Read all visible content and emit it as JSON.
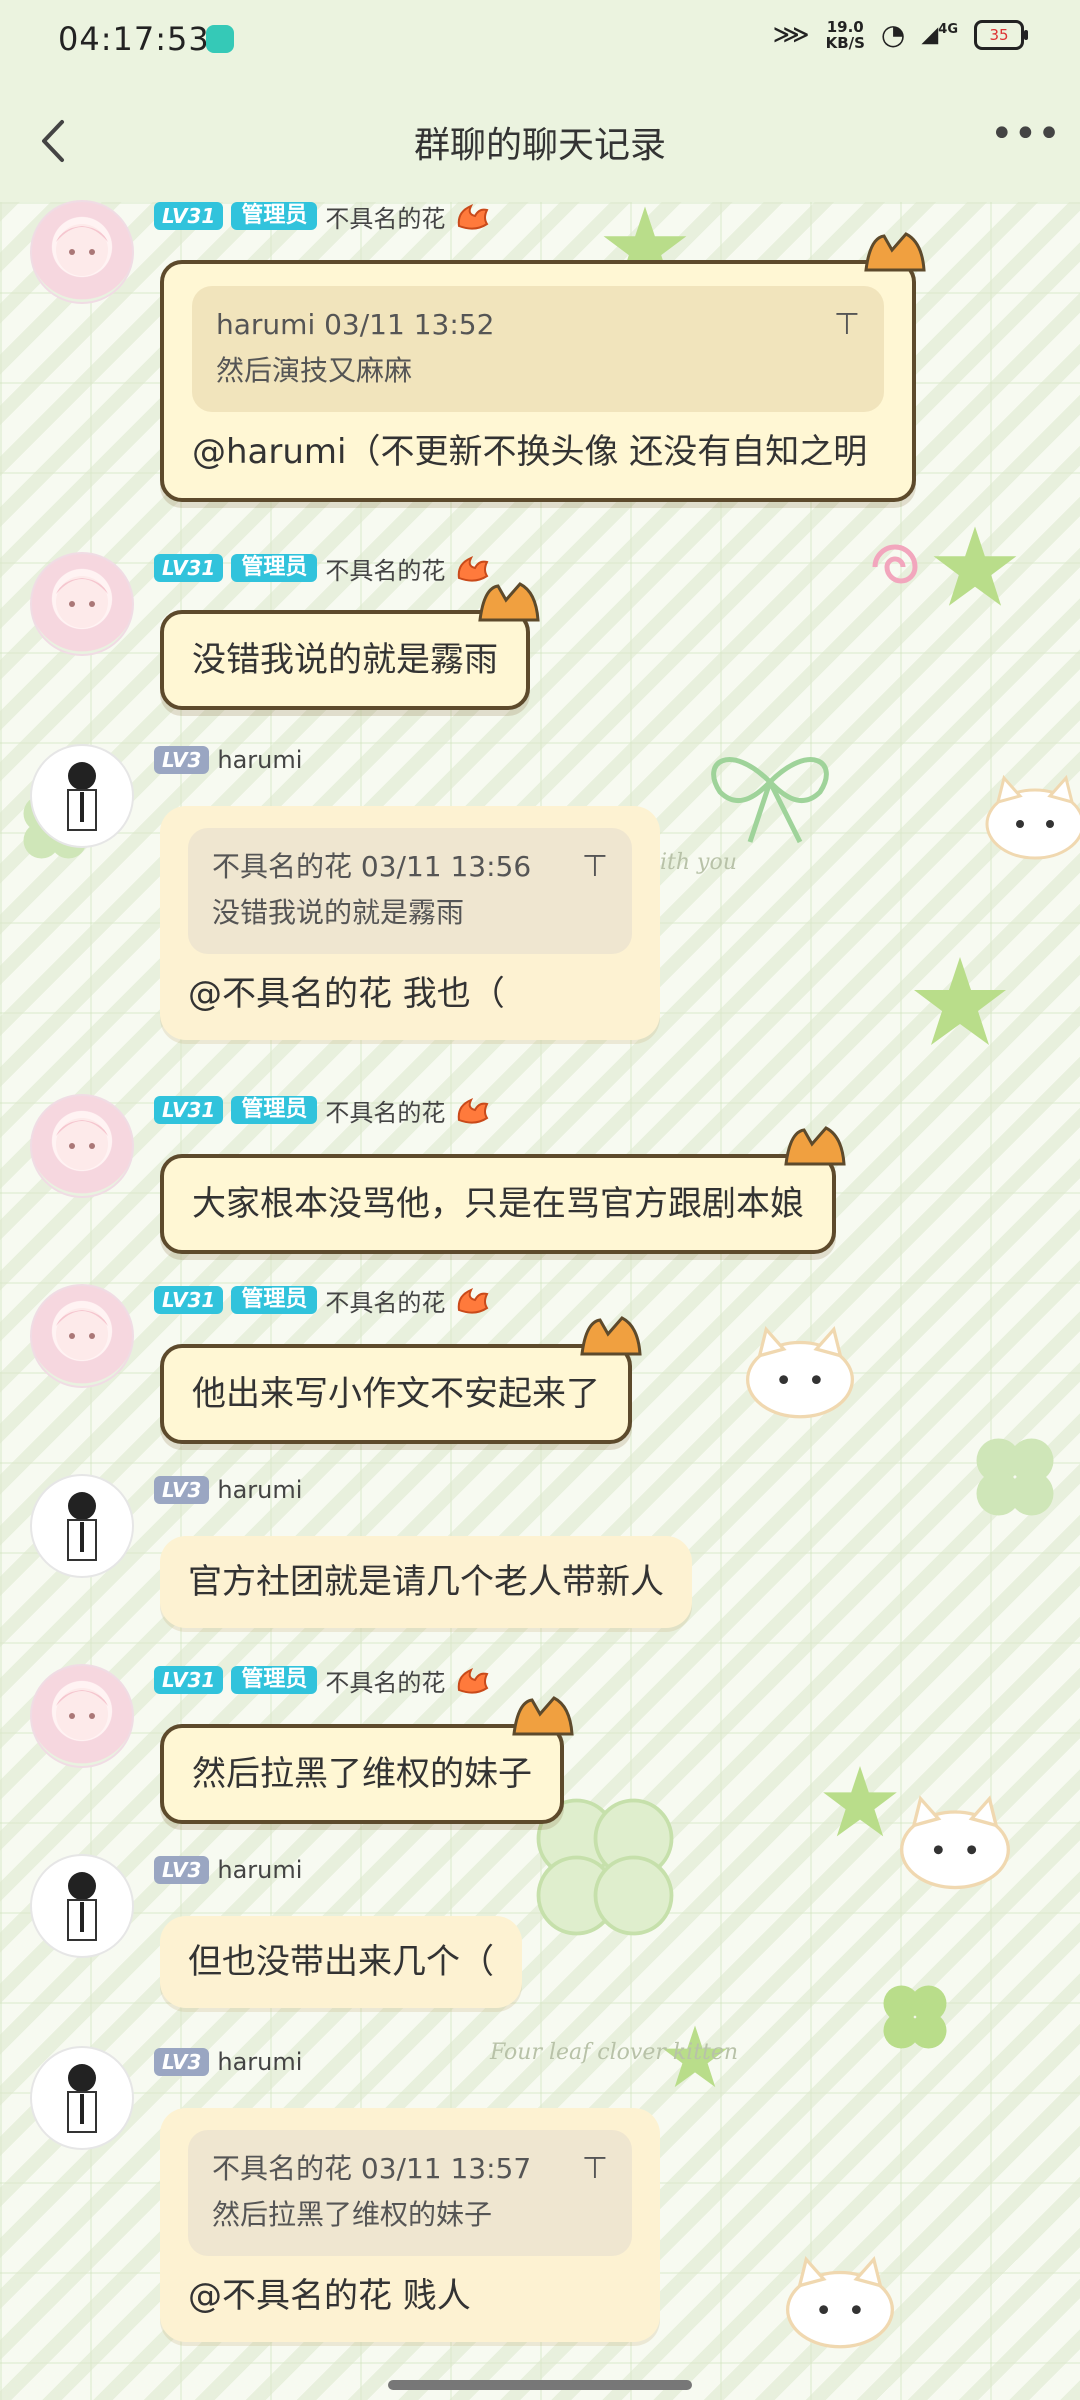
{
  "status_bar": {
    "time": "04:17:53",
    "net_speed_value": "19.0",
    "net_speed_unit": "KB/S",
    "signal_label": "4G",
    "battery": "35"
  },
  "header": {
    "title": "群聊的聊天记录"
  },
  "background_text": {
    "with_you": "ith you",
    "clover": "Four leaf clover kitten"
  },
  "messages": [
    {
      "level": "LV31",
      "role": "管理员",
      "nickname": "不具名的花",
      "quote": {
        "author_time": "harumi 03/11 13:52",
        "text": "然后演技又麻麻"
      },
      "text": "@harumi（不更新不换头像 还没有自知之明"
    },
    {
      "level": "LV31",
      "role": "管理员",
      "nickname": "不具名的花",
      "text": "没错我说的就是霧雨"
    },
    {
      "level": "LV3",
      "nickname": "harumi",
      "quote": {
        "author_time": "不具名的花 03/11 13:56",
        "text": "没错我说的就是霧雨"
      },
      "text": "@不具名的花 我也（"
    },
    {
      "level": "LV31",
      "role": "管理员",
      "nickname": "不具名的花",
      "text": "大家根本没骂他，只是在骂官方跟剧本娘"
    },
    {
      "level": "LV31",
      "role": "管理员",
      "nickname": "不具名的花",
      "text": "他出来写小作文不安起来了"
    },
    {
      "level": "LV3",
      "nickname": "harumi",
      "text": "官方社团就是请几个老人带新人"
    },
    {
      "level": "LV31",
      "role": "管理员",
      "nickname": "不具名的花",
      "text": "然后拉黑了维权的妹子"
    },
    {
      "level": "LV3",
      "nickname": "harumi",
      "text": "但也没带出来几个（"
    },
    {
      "level": "LV3",
      "nickname": "harumi",
      "quote": {
        "author_time": "不具名的花 03/11 13:57",
        "text": "然后拉黑了维权的妹子"
      },
      "text": "@不具名的花 贱人"
    }
  ],
  "icons": {
    "back": "chevron-left-icon",
    "more": "more-dots-icon",
    "pin": "pin-icon"
  },
  "colors": {
    "header_bg": "#ebf3df",
    "admin_badge": "#31c3dc",
    "level_badge": "#9aa6c2",
    "bubble_gold": "#fff7d4",
    "bubble_cream": "#fdf2d2"
  }
}
